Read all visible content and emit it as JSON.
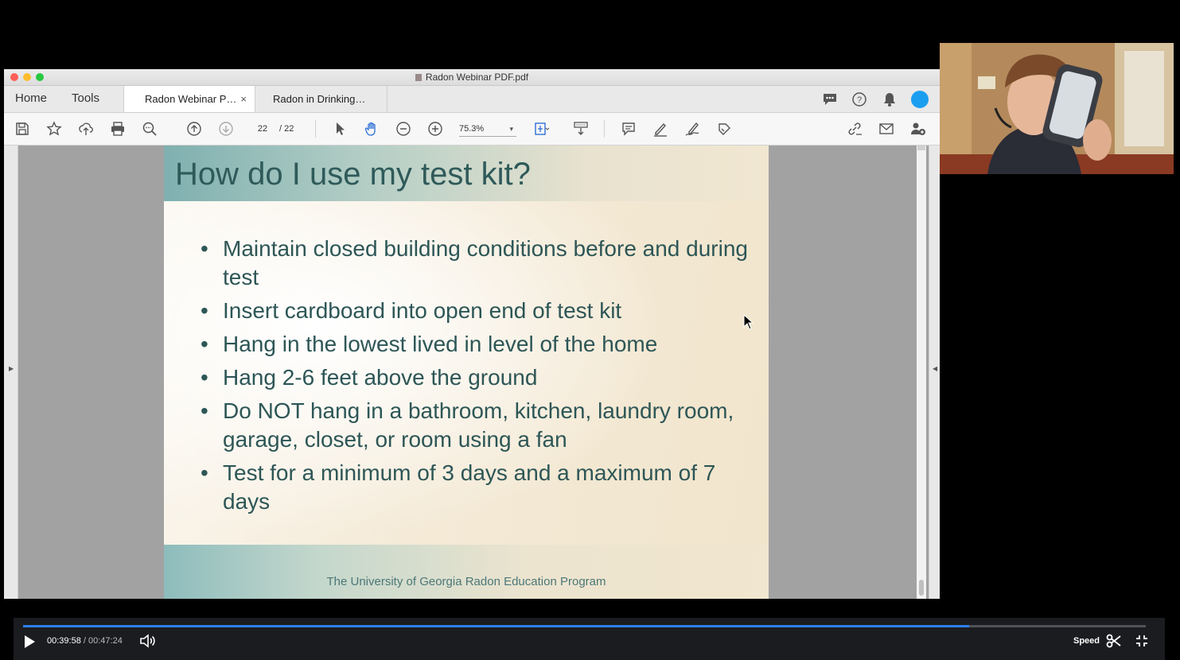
{
  "window": {
    "title": "Radon Webinar PDF.pdf"
  },
  "nav": {
    "home": "Home",
    "tools": "Tools"
  },
  "tabs": [
    {
      "label": "Radon Webinar P…",
      "active": true,
      "close": "×"
    },
    {
      "label": "Radon in Drinking…",
      "active": false
    }
  ],
  "toolbar": {
    "page_current": "22",
    "page_total": "/ 22",
    "zoom": "75.3%",
    "zoom_caret": "▾"
  },
  "slide": {
    "title": "How do I use my test kit?",
    "bullets": [
      "Maintain closed building conditions before and during test",
      "Insert cardboard into open end of test kit",
      "Hang in the lowest lived in level of the home",
      "Hang 2-6 feet above the ground",
      "Do NOT hang in a bathroom, kitchen, laundry room, garage, closet, or room using a fan",
      "Test for a minimum of 3 days and a maximum of 7 days"
    ],
    "footer": "The University of Georgia Radon Education Program"
  },
  "player": {
    "current_time": "00:39:58",
    "separator": " / ",
    "duration": "00:47:24",
    "progress": 0.843,
    "speed_label": "Speed"
  },
  "colors": {
    "traffic_red": "#fe5f57",
    "traffic_yellow": "#febc2e",
    "traffic_green": "#28c840",
    "accent_blue": "#2d7ff0",
    "slide_text": "#2d5656"
  },
  "icons": {
    "toolbar": [
      "save-icon",
      "bookmark-star-icon",
      "upload-cloud-icon",
      "print-icon",
      "zoom-search-icon",
      "page-up-icon",
      "page-down-icon",
      "select-arrow-icon",
      "hand-tool-icon",
      "zoom-out-icon",
      "zoom-in-icon",
      "fit-page-icon",
      "scroll-mode-icon",
      "comment-icon",
      "highlight-pen-icon",
      "sign-pen-icon",
      "edit-stamp-icon",
      "share-link-icon",
      "email-icon",
      "add-user-icon"
    ],
    "tabbar": [
      "chat-icon",
      "help-icon",
      "bell-icon",
      "account-avatar-icon"
    ],
    "player": [
      "play-icon",
      "volume-icon",
      "scissors-icon",
      "exit-fullscreen-icon"
    ]
  }
}
